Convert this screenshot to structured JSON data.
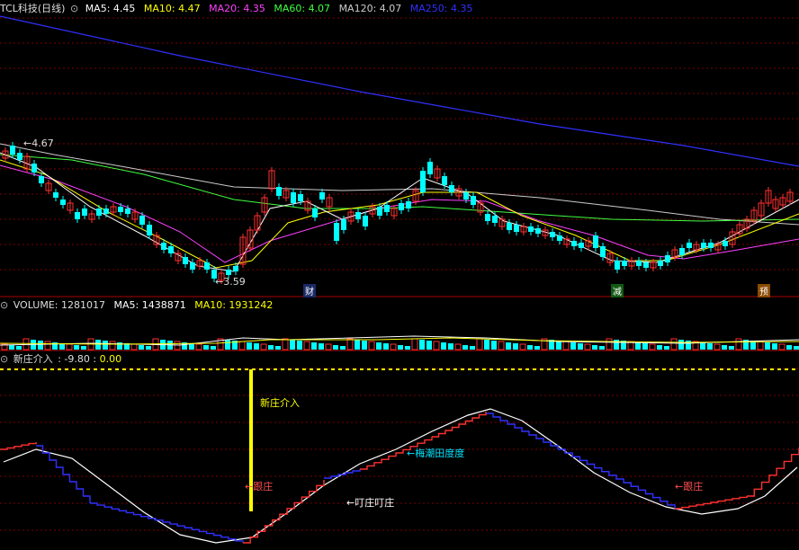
{
  "header": {
    "title": "TCL科技(日线)",
    "ma": [
      {
        "label": "MA5: ",
        "value": "4.45",
        "color": "#ffffff"
      },
      {
        "label": "MA10: ",
        "value": "4.47",
        "color": "#ffff00"
      },
      {
        "label": "MA20: ",
        "value": "4.35",
        "color": "#ff40ff"
      },
      {
        "label": "MA60: ",
        "value": "4.07",
        "color": "#40ff40"
      },
      {
        "label": "MA120: ",
        "value": "4.07",
        "color": "#cccccc"
      },
      {
        "label": "MA250: ",
        "value": "4.35",
        "color": "#3030ff"
      }
    ]
  },
  "price_chart": {
    "high_label": "4.67",
    "low_label": "3.59",
    "events": [
      "财",
      "减",
      "预"
    ]
  },
  "volume_panel": {
    "label": "VOLUME: ",
    "value": "1281017",
    "ma5_label": "MA5: ",
    "ma5_value": "1438871",
    "ma10_label": "MA10: ",
    "ma10_value": "1931242"
  },
  "indicator_panel": {
    "title": "新庄介入",
    "value1": "-9.80",
    "value2": "0.00",
    "annotations": {
      "entry": "新庄介入",
      "follow1": "←跟庄",
      "follow2": "←跟庄",
      "watch": "←叮庄叮庄",
      "garbled": "←梅潮田度度"
    }
  },
  "colors": {
    "up": "#ff3030",
    "down": "#00ffff",
    "grid": "#7a0000",
    "ma250": "#3030ff",
    "indicator_blue": "#3030ff",
    "indicator_red": "#ff3030",
    "yellow": "#ffff00"
  }
}
